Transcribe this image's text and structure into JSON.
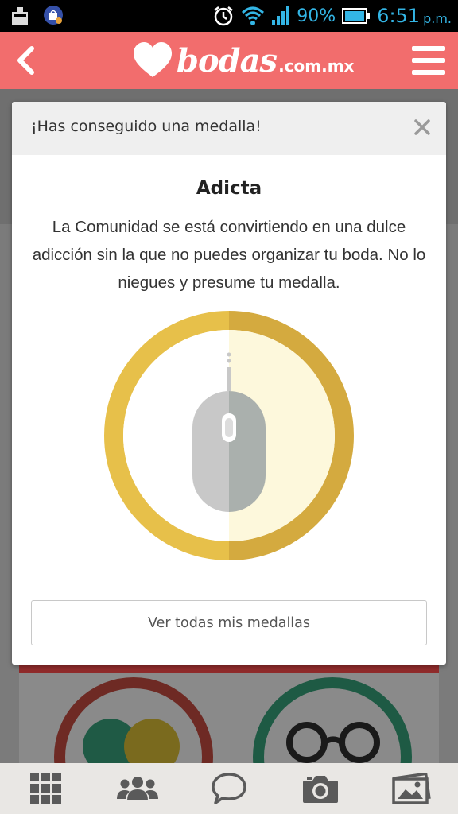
{
  "status_bar": {
    "battery_percent": "90%",
    "time": "6:51",
    "ampm": "p.m.",
    "icons": [
      "cleaner-icon",
      "shop-bag-icon",
      "alarm-icon",
      "wifi-icon",
      "signal-icon",
      "battery-icon"
    ]
  },
  "app_bar": {
    "logo_text": "bodas",
    "logo_domain": ".com.mx",
    "brand_color": "#f26d6d",
    "back_icon": "chevron-left-icon",
    "menu_icon": "hamburger-menu-icon"
  },
  "dialog": {
    "header_title": "¡Has conseguido una medalla!",
    "close_icon": "close-icon",
    "medal_name": "Adicta",
    "medal_description": "La Comunidad se está convirtiendo en una dulce adicción sin la que no puedes organizar tu boda. No lo niegues y presume tu medalla.",
    "medal_icon": "mouse-medal-icon",
    "medal_colors": {
      "ring_light": "#e7c04a",
      "ring_dark": "#d4aa3f",
      "fill_right": "#fdf8dc",
      "mouse_light": "#c8c8c8",
      "mouse_dark": "#aab0ad"
    },
    "all_medals_button": "Ver todas mis medallas"
  },
  "bottom_nav": {
    "items": [
      "grid-icon",
      "community-icon",
      "chat-icon",
      "camera-icon",
      "photos-icon"
    ]
  }
}
